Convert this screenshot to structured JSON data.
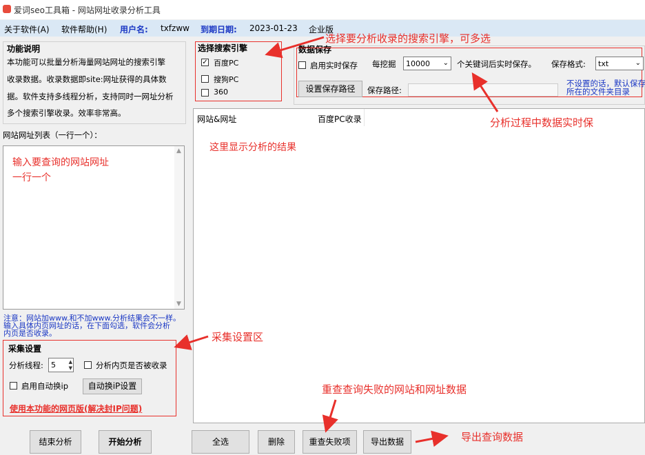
{
  "window": {
    "title": "爱词seo工具箱 - 网站网址收录分析工具"
  },
  "menu": {
    "about": "关于软件(A)",
    "help": "软件帮助(H)",
    "user_label": "用户名:",
    "user_value": "txfzww",
    "expire_label": "到期日期:",
    "expire_value": "2023-01-23",
    "edition": "企业版"
  },
  "feature": {
    "title": "功能说明",
    "line1": "本功能可以批量分析海量网站网址的搜索引擎",
    "line2": "收录数据。收录数据即site:网址获得的具体数",
    "line3": "据。软件支持多线程分析，支持同时一网址分析",
    "line4": "多个搜索引擎收录。效率非常高。"
  },
  "url_list": {
    "label": "网站网址列表（一行一个）：",
    "hint1": "输入要查询的网站网址",
    "hint2": "一行一个"
  },
  "note": {
    "line1": "注意：网站加www.和不加www.分析结果会不一样。",
    "line2": "输入具体内页网址的话，在下面勾选，软件会分析",
    "line3": "内页是否收录。"
  },
  "collect": {
    "title": "采集设置",
    "threads_label": "分析线程:",
    "threads_value": "5",
    "inner_page_label": "分析内页是否被收录",
    "auto_ip_label": "启用自动换ip",
    "auto_ip_button": "自动换iP设置",
    "web_link": "使用本功能的网页版(解决封IP问题)"
  },
  "engines": {
    "title": "选择搜索引擎",
    "items": [
      {
        "label": "百度PC",
        "checked": true
      },
      {
        "label": "搜狗PC",
        "checked": false
      },
      {
        "label": "360",
        "checked": false
      }
    ]
  },
  "save": {
    "title": "数据保存",
    "realtime_label": "启用实时保存",
    "every_label": "每挖掘",
    "every_value": "10000",
    "after_label": "个关键词后实时保存。",
    "format_label": "保存格式:",
    "format_value": "txt",
    "path_button": "设置保存路径",
    "path_label": "保存路径:",
    "path_value": "",
    "default_note1": "不设置的话，默认保存",
    "default_note2": "所在的文件夹目录"
  },
  "results": {
    "columns": [
      "网站&网址",
      "百度PC收录"
    ],
    "placeholder": "这里显示分析的结果"
  },
  "buttons": {
    "stop": "结束分析",
    "start": "开始分析",
    "select_all": "全选",
    "delete": "删除",
    "recheck": "重查失败项",
    "export": "导出数据"
  },
  "annotations": {
    "engines": "选择要分析收录的搜索引擎，可多选",
    "realtime": "分析过程中数据实时保",
    "collect": "采集设置区",
    "recheck": "重查查询失败的网站和网址数据",
    "export": "导出查询数据"
  },
  "colors": {
    "annotation_red": "#e8302b",
    "menu_bg": "#dae8f5",
    "link_blue": "#1a37c4"
  }
}
